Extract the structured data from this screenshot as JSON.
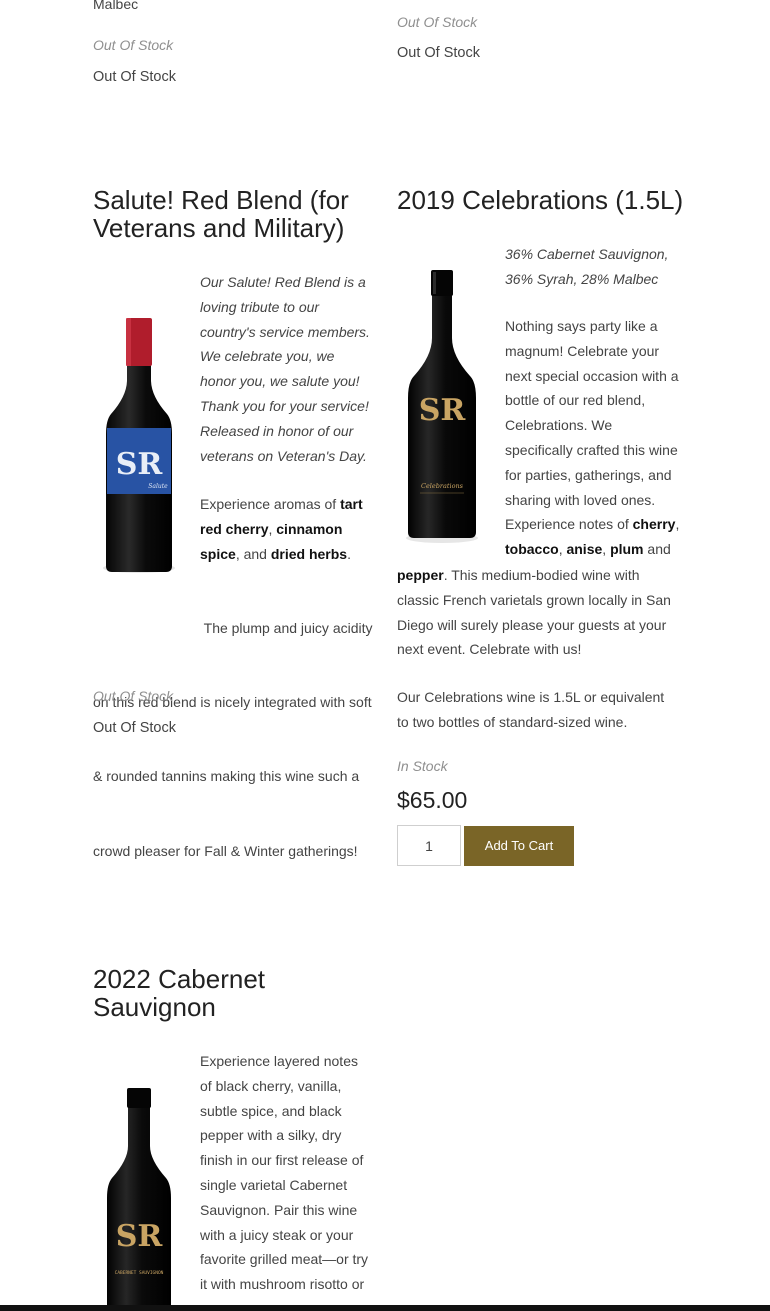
{
  "top_partial": {
    "left_cut_text": "Malbec",
    "left_status_italic": "Out Of Stock",
    "left_status": "Out Of Stock",
    "right_status_italic": "Out Of Stock",
    "right_status": "Out Of Stock"
  },
  "products": [
    {
      "title_line1": "Salute! Red Blend (for",
      "title_line2": "Veterans and Military)",
      "italic_lines": [
        "Our Salute! Red Blend is a",
        "loving tribute to our",
        "country's service members.",
        "We celebrate you, we",
        "honor you, we salute you!",
        "Thank you for your service!",
        "Released in honor of our",
        "veterans on Veteran's Day."
      ],
      "aroma_pre": "Experience aromas of ",
      "aroma_1": "tart",
      "aroma_1b": "red cherry",
      "aroma_2": "cinnamon",
      "aroma_2b": "spice",
      "aroma_mid": ", and ",
      "aroma_3": "dried herbs",
      "body_lines": [
        " The plump and juicy acidity",
        "on this red blend is nicely integrated with soft",
        "& rounded tannins making this wine such a",
        "crowd pleaser for Fall & Winter gatherings!"
      ],
      "status_italic": "Out Of Stock",
      "status": "Out Of Stock",
      "bottle_label": "Salute"
    },
    {
      "title": "2019 Celebrations (1.5L)",
      "varietals_line1": "36% Cabernet Sauvignon,",
      "varietals_line2": "36% Syrah, 28% Malbec",
      "desc_lines": [
        "Nothing says party like a",
        "magnum! Celebrate your",
        "next special occasion with a",
        "bottle of our red blend,",
        "Celebrations. We",
        "specifically crafted this wine",
        "for parties, gatherings, and",
        "sharing with loved ones."
      ],
      "notes_pre": "Experience notes of ",
      "note_cherry": "cherry",
      "note_tobacco": "tobacco",
      "note_anise": "anise",
      "note_plum": "plum",
      "note_and": " and",
      "note_pepper": "pepper",
      "tail_1": ". This medium-bodied wine with",
      "tail_lines": [
        "classic French varietals grown locally in San",
        "Diego will surely please your guests at your",
        "next event. Celebrate with us!"
      ],
      "size_lines": [
        "Our Celebrations wine is 1.5L or equivalent",
        "to two bottles of standard-sized wine."
      ],
      "status_italic": "In Stock",
      "price": "$65.00",
      "quantity": "1",
      "add_to_cart": "Add To Cart",
      "bottle_label": "Celebrations"
    },
    {
      "title_line1": "2022 Cabernet",
      "title_line2": "Sauvignon",
      "desc_lines": [
        "Experience layered notes",
        "of black cherry, vanilla,",
        "subtle spice, and black",
        "pepper with a silky, dry",
        "finish in our first release of",
        "single varietal Cabernet",
        "Sauvignon. Pair this wine",
        "with a juicy steak or your",
        "favorite grilled meat—or try",
        "it with mushroom risotto or"
      ],
      "bottle_label": "CABERNET SAUVIGNON"
    }
  ],
  "logo_text": "SR",
  "colors": {
    "accent_button": "#7a6527",
    "gold": "#c9a463",
    "salute_blue": "#2f5fb4",
    "capsule_red": "#b01d2c"
  }
}
